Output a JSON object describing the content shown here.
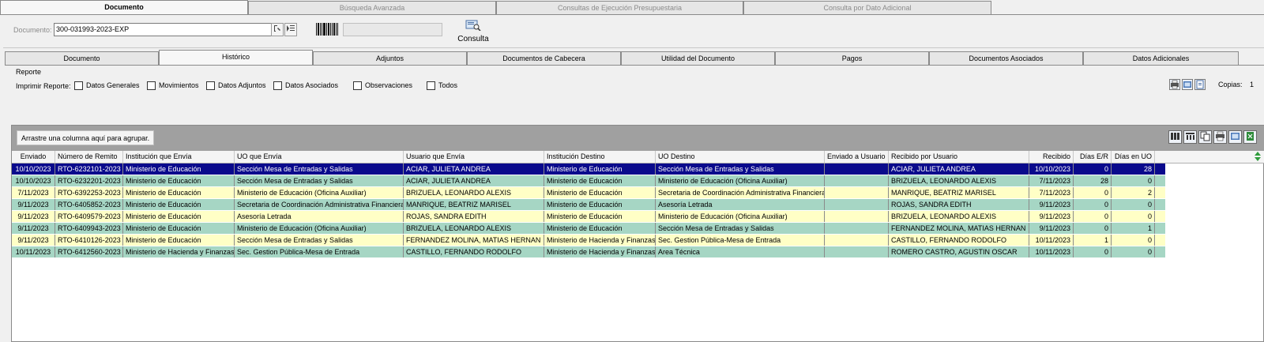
{
  "top_tabs": [
    {
      "label": "Documento",
      "active": true
    },
    {
      "label": "Búsqueda Avanzada",
      "active": false
    },
    {
      "label": "Consultas de Ejecución Presupuestaria",
      "active": false
    },
    {
      "label": "Consulta por Dato Adicional",
      "active": false
    }
  ],
  "search": {
    "label": "Documento:",
    "value": "300-031993-2023-EXP",
    "consulta_label": "Consulta"
  },
  "sub_tabs": [
    {
      "label": "Documento",
      "active": false
    },
    {
      "label": "Histórico",
      "active": true
    },
    {
      "label": "Adjuntos",
      "active": false
    },
    {
      "label": "Documentos de Cabecera",
      "active": false
    },
    {
      "label": "Utilidad del Documento",
      "active": false
    },
    {
      "label": "Pagos",
      "active": false
    },
    {
      "label": "Documentos Asociados",
      "active": false
    },
    {
      "label": "Datos Adicionales",
      "active": false
    }
  ],
  "report": {
    "title": "Reporte",
    "print_label": "Imprimir Reporte:",
    "checkboxes": [
      {
        "label": "Datos Generales",
        "checked": false
      },
      {
        "label": "Movimientos",
        "checked": false
      },
      {
        "label": "Datos Adjuntos",
        "checked": false
      },
      {
        "label": "Datos Asociados",
        "checked": false
      },
      {
        "label": "Observaciones",
        "checked": false
      },
      {
        "label": "Todos",
        "checked": false
      }
    ],
    "copias_label": "Copias:",
    "copias_value": "1"
  },
  "grid": {
    "group_hint": "Arrastre una columna aquí para agrupar.",
    "columns": [
      "Enviado",
      "Número de Remito",
      "Institución que Envía",
      "UO que Envía",
      "Usuario que Envía",
      "Institución Destino",
      "UO Destino",
      "Enviado a Usuario",
      "Recibido por Usuario",
      "Recibido",
      "Días E/R",
      "Días en UO"
    ],
    "rows": [
      {
        "style": "selected",
        "cells": [
          "10/10/2023",
          "RTO-6232101-2023",
          "Ministerio de Educación",
          "Sección Mesa de Entradas y Salidas",
          "ACIAR, JULIETA ANDREA",
          "Ministerio de Educación",
          "Sección Mesa de Entradas y Salidas",
          "",
          "ACIAR, JULIETA ANDREA",
          "10/10/2023",
          "0",
          "28"
        ]
      },
      {
        "style": "green",
        "cells": [
          "10/10/2023",
          "RTO-6232201-2023",
          "Ministerio de Educación",
          "Sección Mesa de Entradas y Salidas",
          "ACIAR, JULIETA ANDREA",
          "Ministerio de Educación",
          "Ministerio de Educación (Oficina Auxiliar)",
          "",
          "BRIZUELA, LEONARDO ALEXIS",
          "7/11/2023",
          "28",
          "0"
        ]
      },
      {
        "style": "yellow",
        "cells": [
          "7/11/2023",
          "RTO-6392253-2023",
          "Ministerio de Educación",
          "Ministerio de Educación (Oficina Auxiliar)",
          "BRIZUELA, LEONARDO ALEXIS",
          "Ministerio de Educación",
          " Secretaria de Coordinación Administrativa Financiera",
          "",
          "MANRIQUE, BEATRIZ MARISEL",
          "7/11/2023",
          "0",
          "2"
        ]
      },
      {
        "style": "green",
        "cells": [
          "9/11/2023",
          "RTO-6405852-2023",
          "Ministerio de Educación",
          " Secretaria de Coordinación Administrativa Financiera",
          "MANRIQUE, BEATRIZ MARISEL",
          "Ministerio de Educación",
          "Asesoría Letrada",
          "",
          "ROJAS, SANDRA EDITH",
          "9/11/2023",
          "0",
          "0"
        ]
      },
      {
        "style": "yellow",
        "cells": [
          "9/11/2023",
          "RTO-6409579-2023",
          "Ministerio de Educación",
          "Asesoría Letrada",
          "ROJAS, SANDRA EDITH",
          "Ministerio de Educación",
          "Ministerio de Educación (Oficina Auxiliar)",
          "",
          "BRIZUELA, LEONARDO ALEXIS",
          "9/11/2023",
          "0",
          "0"
        ]
      },
      {
        "style": "green",
        "cells": [
          "9/11/2023",
          "RTO-6409943-2023",
          "Ministerio de Educación",
          "Ministerio de Educación (Oficina Auxiliar)",
          "BRIZUELA, LEONARDO ALEXIS",
          "Ministerio de Educación",
          "Sección Mesa de Entradas y Salidas",
          "",
          "FERNANDEZ MOLINA, MATIAS HERNAN",
          "9/11/2023",
          "0",
          "1"
        ]
      },
      {
        "style": "yellow",
        "cells": [
          "9/11/2023",
          "RTO-6410126-2023",
          "Ministerio de Educación",
          "Sección Mesa de Entradas y Salidas",
          "FERNANDEZ MOLINA, MATIAS HERNAN",
          "Ministerio de Hacienda y Finanzas",
          " Sec. Gestion Pública-Mesa de Entrada",
          "",
          "CASTILLO, FERNANDO RODOLFO",
          "10/11/2023",
          "1",
          "0"
        ]
      },
      {
        "style": "green",
        "cells": [
          "10/11/2023",
          "RTO-6412560-2023",
          "Ministerio de Hacienda y Finanzas",
          " Sec. Gestion Pública-Mesa de Entrada",
          "CASTILLO, FERNANDO RODOLFO",
          "Ministerio de Hacienda y Finanzas",
          "Area Técnica",
          "",
          "ROMERO CASTRO, AGUSTIN OSCAR",
          "10/11/2023",
          "0",
          "0"
        ]
      }
    ]
  }
}
